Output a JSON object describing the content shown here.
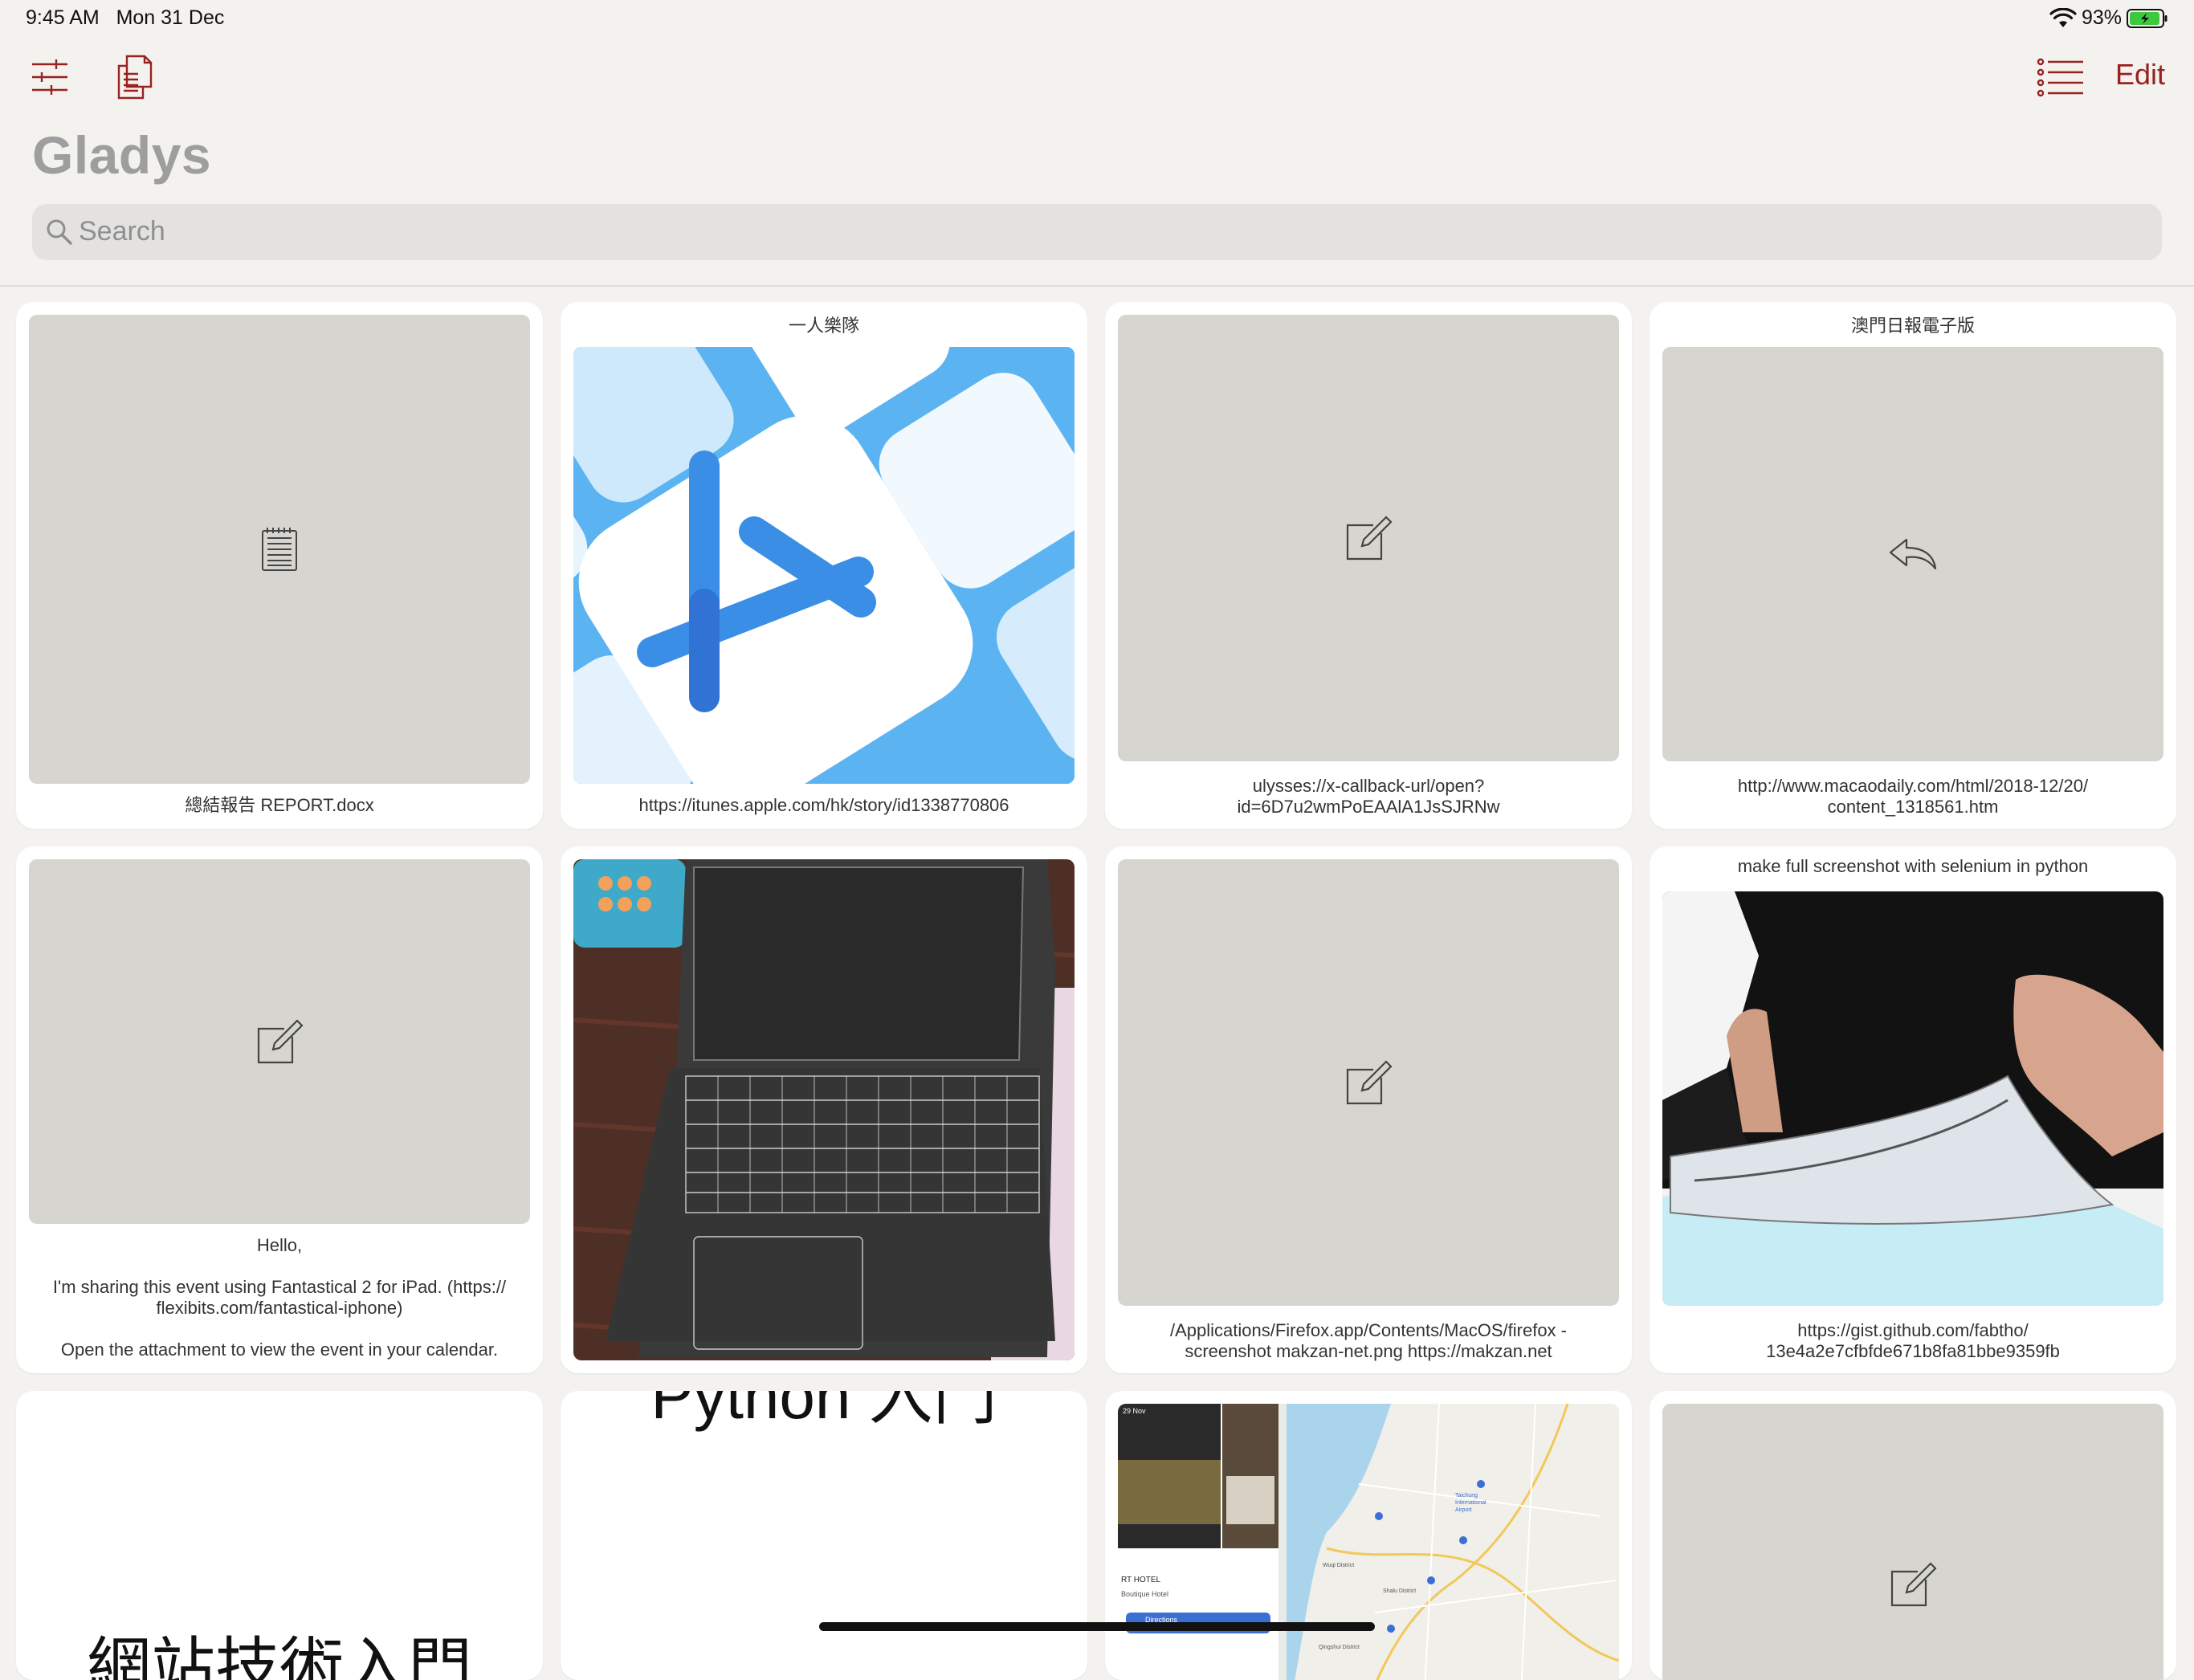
{
  "status_bar": {
    "time": "9:45 AM",
    "date": "Mon 31 Dec",
    "battery": "93%"
  },
  "toolbar": {
    "edit_label": "Edit"
  },
  "app": {
    "title": "Gladys"
  },
  "search": {
    "placeholder": "Search"
  },
  "cards": [
    {
      "top": "",
      "bottom": "總結報告 REPORT.docx",
      "icon": "document-icon"
    },
    {
      "top": "一人樂隊",
      "bottom": "https://itunes.apple.com/hk/story/id1338770806",
      "icon": "app-store-artwork"
    },
    {
      "top": "",
      "bottom": "ulysses://x-callback-url/open?\nid=6D7u2wmPoEAAlA1JsSJRNw",
      "icon": "compose-icon"
    },
    {
      "top": "澳門日報電子版",
      "bottom": "http://www.macaodaily.com/html/2018-12/20/\ncontent_1318561.htm",
      "icon": "reply-icon"
    },
    {
      "top": "",
      "bottom": "Hello,\n\nI'm sharing this event using Fantastical 2 for iPad. (https://\nflexibits.com/fantastical-iphone)\n\nOpen the attachment to view the event in your calendar.",
      "icon": "compose-icon"
    },
    {
      "top": "",
      "bottom": "",
      "icon": "laptop-photo"
    },
    {
      "top": "",
      "bottom": "/Applications/Firefox.app/Contents/MacOS/firefox -\nscreenshot makzan-net.png https://makzan.net",
      "icon": "compose-icon"
    },
    {
      "top": "make full screenshot with selenium in python",
      "bottom": "https://gist.github.com/fabtho/\n13e4a2e7cfbfde671b8fa81bbe9359fb",
      "icon": "paper-photo"
    },
    {
      "top": "",
      "bottom": "",
      "text_preview": "網站技術入門",
      "icon": "text-preview"
    },
    {
      "top": "",
      "bottom": "",
      "text_preview": "Python 入門",
      "icon": "text-preview"
    },
    {
      "top": "",
      "bottom": "",
      "map_labels": [
        "29 Nov",
        "RT HOTEL",
        "Boutique Hotel",
        "Directions",
        "Taichung International Airport",
        "Shalu District",
        "Wuqi District",
        "Qingshui District"
      ],
      "icon": "map-screenshot"
    },
    {
      "top": "",
      "bottom": "",
      "icon": "compose-icon"
    }
  ]
}
